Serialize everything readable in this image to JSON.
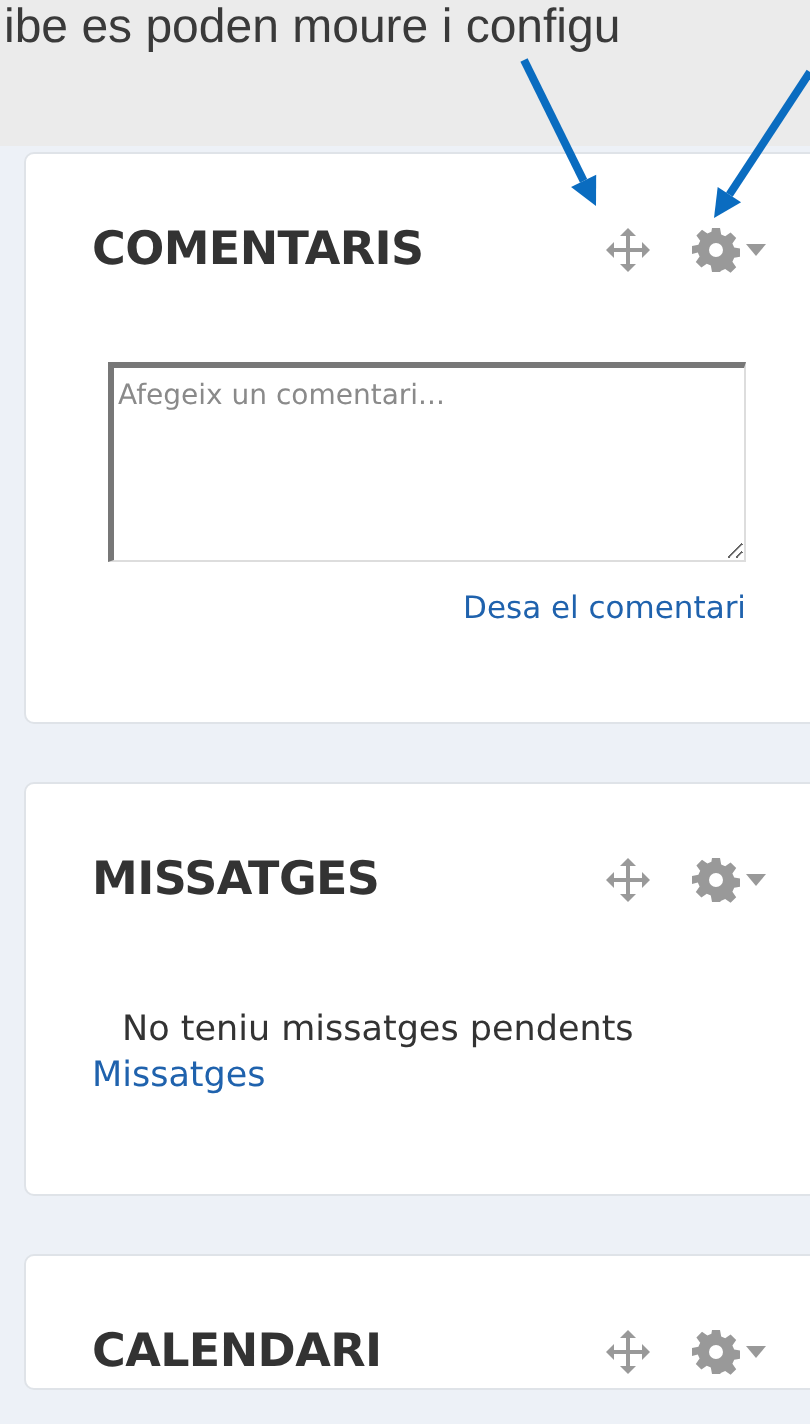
{
  "caption": "ibe es poden moure i configu",
  "blocks": [
    {
      "kind": "comments",
      "title": "COMENTARIS",
      "placeholder": "Afegeix un comentari...",
      "save_link": "Desa el comentari"
    },
    {
      "kind": "messages",
      "title": "MISSATGES",
      "message": "No teniu missatges pendents",
      "link": "Missatges"
    },
    {
      "kind": "calendar",
      "title": "CALENDARI"
    }
  ]
}
